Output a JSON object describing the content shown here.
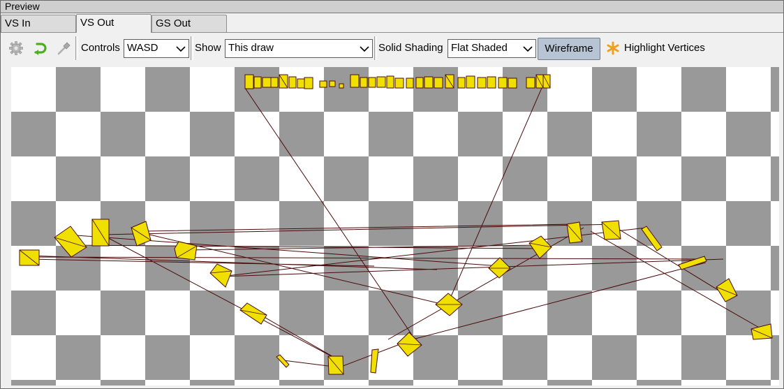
{
  "window": {
    "title": "Preview"
  },
  "tabs": [
    {
      "label": "VS In",
      "active": false
    },
    {
      "label": "VS Out",
      "active": true
    },
    {
      "label": "GS Out",
      "active": false
    }
  ],
  "toolbar": {
    "settings_icon": "gear-icon",
    "reset_icon": "undo-arrow-icon",
    "pick_icon": "eyedropper-icon",
    "controls_label": "Controls",
    "controls_value": "WASD",
    "show_label": "Show",
    "show_value": "This draw",
    "shading_label": "Solid Shading",
    "shading_value": "Flat Shaded",
    "wireframe_label": "Wireframe",
    "wireframe_active": true,
    "highlight_icon": "asterisk-icon",
    "highlight_label": "Highlight Vertices"
  },
  "viewport": {
    "checker_dark": "#999999",
    "checker_light": "#ffffff",
    "fill_color": "#f0e000",
    "wire_color": "#4a0a0a"
  }
}
